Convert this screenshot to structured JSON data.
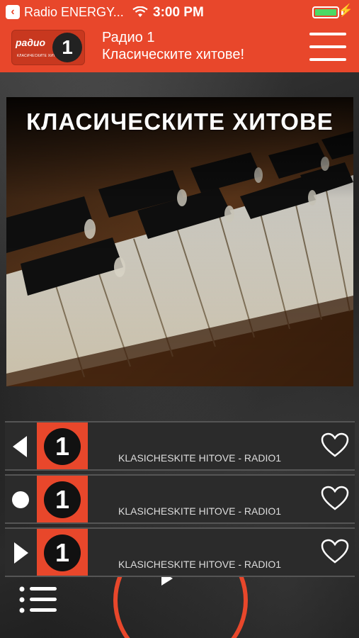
{
  "status": {
    "back_glyph": "‹",
    "carrier": "Radio ENERGY...",
    "time": "3:00 PM",
    "charge_glyph": "⚡"
  },
  "header": {
    "logo_text": "радио",
    "logo_sub": "КЛАСИЧЕСКИТЕ ХИТОВЕ",
    "logo_number": "1",
    "title": "Радио 1",
    "subtitle": "Класическите хитове!"
  },
  "artwork": {
    "title": "КЛАСИЧЕСКИТЕ ХИТОВЕ"
  },
  "playlist": [
    {
      "control": "◀",
      "thumb_number": "1",
      "title": "KLASICHESKITE HITOVE - RADIO1"
    },
    {
      "control": "●",
      "thumb_number": "1",
      "title": "KLASICHESKITE HITOVE - RADIO1"
    },
    {
      "control": "▶",
      "thumb_number": "1",
      "title": "KLASICHESKITE HITOVE - RADIO1"
    }
  ],
  "colors": {
    "accent": "#e8472b",
    "battery": "#4cd964"
  },
  "icons": {
    "menu": "hamburger-icon",
    "favorite": "heart-icon",
    "list": "list-icon",
    "wifi": "wifi-icon"
  }
}
